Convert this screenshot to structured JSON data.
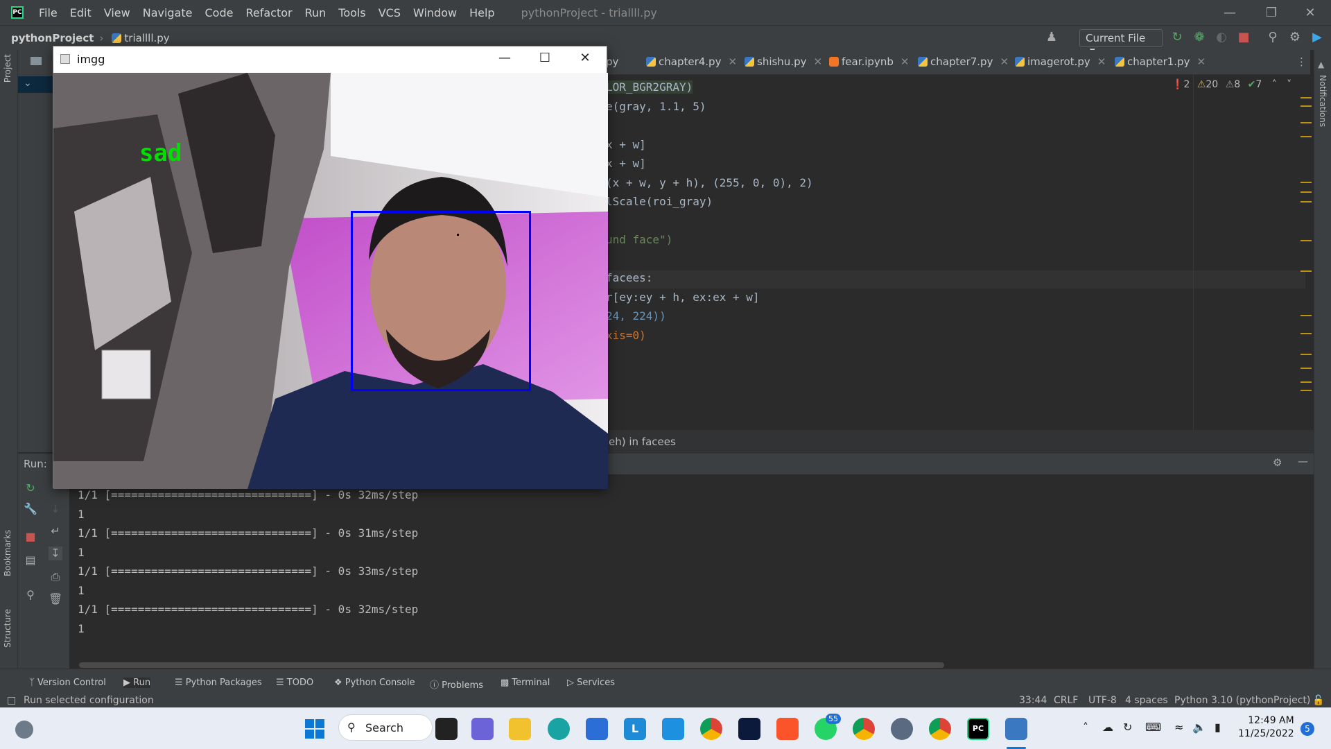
{
  "menubar": {
    "items": [
      "File",
      "Edit",
      "View",
      "Navigate",
      "Code",
      "Refactor",
      "Run",
      "Tools",
      "VCS",
      "Window",
      "Help"
    ],
    "window_title": "pythonProject - triallll.py"
  },
  "navbar": {
    "project": "pythonProject",
    "file": "triallll.py",
    "run_config": "Current File"
  },
  "tabs": [
    "py",
    "chapter4.py",
    "shishu.py",
    "fear.ipynb",
    "chapter7.py",
    "imagerot.py",
    "chapter1.py"
  ],
  "inspections": {
    "errors": "2",
    "warnings": "20",
    "weak_warnings": "8",
    "typos": "7"
  },
  "code": [
    "LOR_BGR2GRAY)",
    "e(gray, 1.1, 5)",
    "",
    "x + w]",
    "x + w]",
    "(x + w, y + h), (255, 0, 0), 2)",
    "lScale(roi_gray)",
    "",
    "und face\")",
    "",
    "facees:",
    "r[ey:ey + h, ex:ex + w]",
    "24, 224))",
    "xis=0)"
  ],
  "editor_breadcrumb": "eh) in facees",
  "run": {
    "label": "Run:",
    "output": [
      "1/1 [==============================] - 0s 32ms/step",
      "1",
      "1/1 [==============================] - 0s 31ms/step",
      "1",
      "1/1 [==============================] - 0s 33ms/step",
      "1",
      "1/1 [==============================] - 0s 32ms/step",
      "1"
    ]
  },
  "tool_tabs": [
    "Version Control",
    "Run",
    "Python Packages",
    "TODO",
    "Python Console",
    "Problems",
    "Terminal",
    "Services"
  ],
  "side_labels": {
    "project": "Project",
    "bookmarks": "Bookmarks",
    "structure": "Structure",
    "notifications": "Notifications"
  },
  "status": {
    "message": "Run selected configuration",
    "position": "33:44",
    "line_sep": "CRLF",
    "encoding": "UTF-8",
    "indent": "4 spaces",
    "interpreter": "Python 3.10 (pythonProject)"
  },
  "imgwin": {
    "title": "imgg",
    "emotion": "sad"
  },
  "taskbar": {
    "search": "Search",
    "time": "12:49 AM",
    "date": "11/25/2022",
    "whatsapp_badge": "55",
    "notif_badge": "5"
  }
}
